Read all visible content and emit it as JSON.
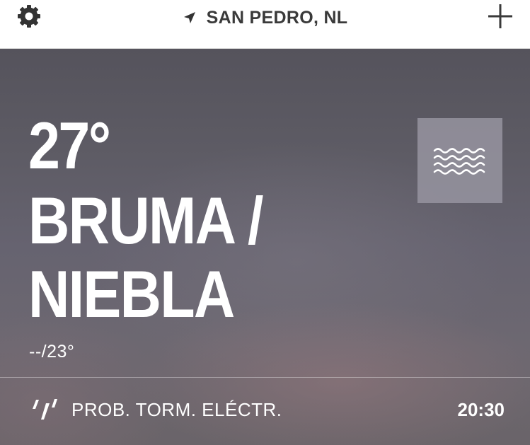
{
  "header": {
    "settings_icon": "gear-icon",
    "location_icon": "location-arrow-icon",
    "location": "SAN PEDRO, NL",
    "add_icon": "plus-icon"
  },
  "current": {
    "temperature": "27°",
    "condition_line1": "BRUMA /",
    "condition_line2": "NIEBLA",
    "high_low": "--/23°",
    "condition_icon": "fog-waves-icon"
  },
  "alert": {
    "icon": "rain-icon",
    "text": "PROB. TORM. ELÉCTR.",
    "time": "20:30"
  },
  "colors": {
    "header_bg": "#ffffff",
    "header_text": "#3a3a3a",
    "main_bg": "#5d5b64",
    "text": "#ffffff"
  }
}
